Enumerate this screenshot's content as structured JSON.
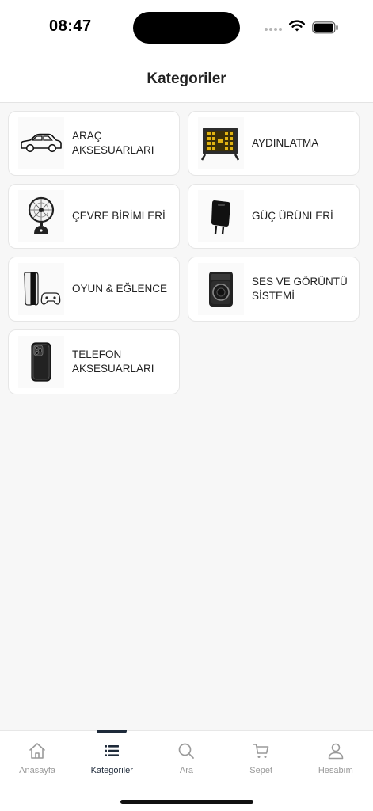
{
  "status_bar": {
    "time": "08:47"
  },
  "header": {
    "title": "Kategoriler"
  },
  "categories": [
    {
      "label": "ARAÇ\nAKSESUARLARI",
      "icon": "car-icon"
    },
    {
      "label": "AYDINLATMA",
      "icon": "floodlight-icon"
    },
    {
      "label": "ÇEVRE BİRİMLERİ",
      "icon": "desk-fan-icon"
    },
    {
      "label": "GÜÇ ÜRÜNLERİ",
      "icon": "wall-charger-icon"
    },
    {
      "label": "OYUN & EĞLENCE",
      "icon": "game-console-icon"
    },
    {
      "label": "SES VE GÖRÜNTÜ\nSİSTEMİ",
      "icon": "speaker-icon"
    },
    {
      "label": "TELEFON\nAKSESUARLARI",
      "icon": "phone-case-icon"
    }
  ],
  "tabbar": {
    "active": "Kategoriler",
    "tabs": [
      {
        "label": "Anasayfa",
        "icon": "home-icon"
      },
      {
        "label": "Kategoriler",
        "icon": "list-icon"
      },
      {
        "label": "Ara",
        "icon": "search-icon"
      },
      {
        "label": "Sepet",
        "icon": "cart-icon"
      },
      {
        "label": "Hesabım",
        "icon": "user-icon"
      }
    ]
  }
}
